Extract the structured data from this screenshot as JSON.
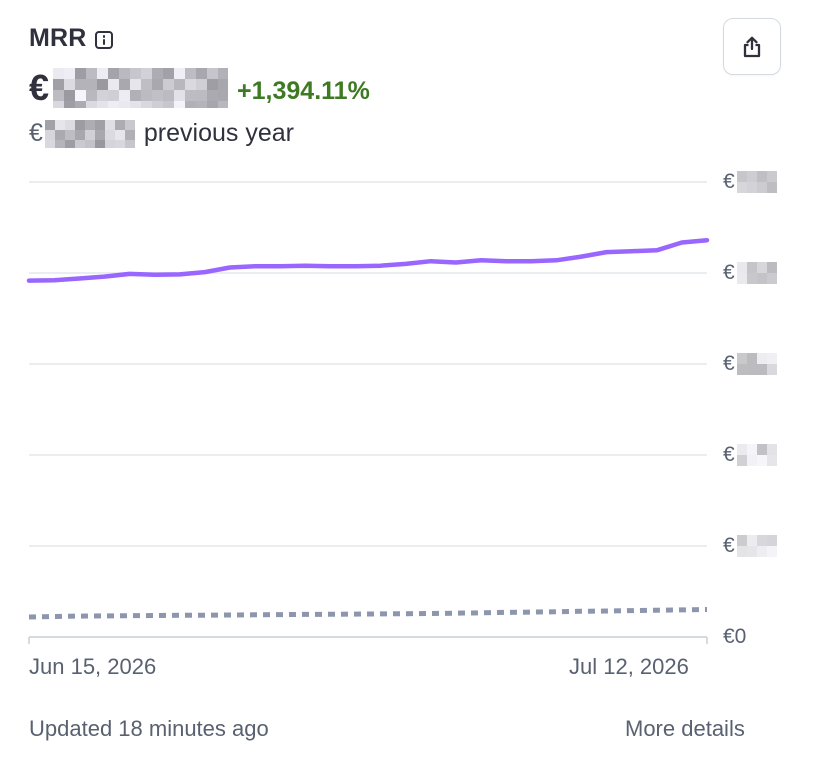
{
  "card": {
    "title": "MRR",
    "currency_symbol": "€",
    "change_text": "+1,394.11%",
    "previous_label": "previous year",
    "footer_updated": "Updated 18 minutes ago",
    "footer_link": "More details",
    "icons": {
      "info": "info-icon",
      "share": "share-icon"
    }
  },
  "chart_data": {
    "type": "line",
    "x_tick_labels": [
      "Jun 15, 2026",
      "Jul 12, 2026"
    ],
    "y_tick_labels": [
      "€0"
    ],
    "y_tick_count": 6,
    "colors": {
      "current": "#9966ff",
      "previous": "#8d96ac",
      "gridline": "#ebeef1"
    },
    "series": [
      {
        "style": "solid",
        "values": [
          3.917,
          3.92,
          3.94,
          3.96,
          3.99,
          3.98,
          3.985,
          4.01,
          4.06,
          4.075,
          4.075,
          4.08,
          4.075,
          4.075,
          4.08,
          4.1,
          4.13,
          4.115,
          4.14,
          4.13,
          4.13,
          4.14,
          4.18,
          4.23,
          4.24,
          4.25,
          4.335,
          4.36
        ]
      },
      {
        "style": "dotted",
        "values": [
          0.22,
          0.225,
          0.23,
          0.232,
          0.234,
          0.236,
          0.238,
          0.24,
          0.242,
          0.244,
          0.246,
          0.248,
          0.25,
          0.252,
          0.254,
          0.256,
          0.258,
          0.262,
          0.266,
          0.27,
          0.274,
          0.278,
          0.282,
          0.286,
          0.29,
          0.294,
          0.298,
          0.302
        ]
      }
    ],
    "ylim": [
      0,
      5
    ],
    "grid": true,
    "legend": "none"
  }
}
